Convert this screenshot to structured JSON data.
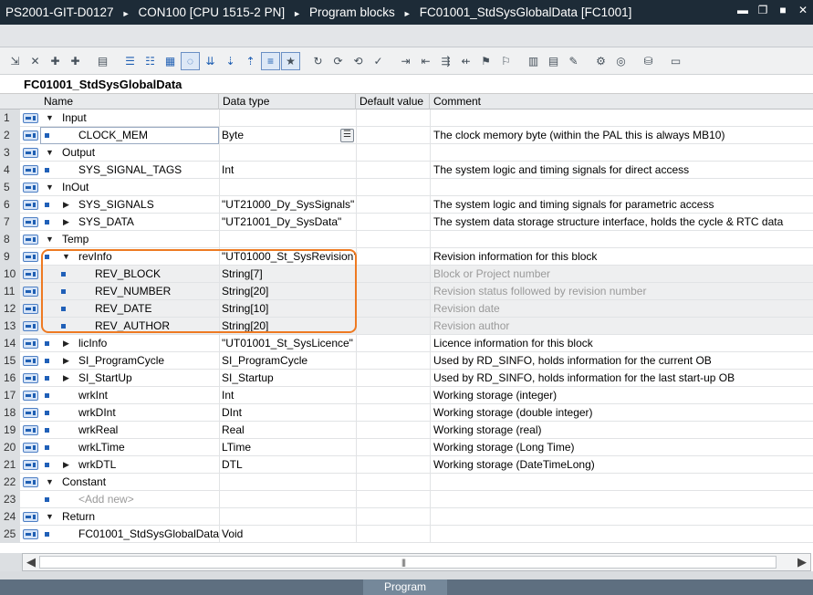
{
  "window": {
    "breadcrumb": [
      "PS2001-GIT-D0127",
      "CON100 [CPU 1515-2 PN]",
      "Program blocks",
      "FC01001_StdSysGlobalData [FC1001]"
    ],
    "controls": [
      "minimize",
      "restore",
      "maximize",
      "close"
    ]
  },
  "toolbar": {
    "icons": [
      "insert-row-icon",
      "delete-row-icon",
      "insert-network-icon",
      "add-network-icon",
      "monitor-icon",
      "view-block-icon",
      "view-network-icon",
      "view-table-icon",
      "comment-icon",
      "expand-all-icon",
      "expand-icon",
      "collapse-icon",
      "list-icon",
      "favorites-icon",
      "goto-icon",
      "goto-next-icon",
      "goto-prev-icon",
      "check-icon",
      "indent-icon",
      "outdent-icon",
      "comment-lines-icon",
      "uncomment-lines-icon",
      "bookmark-icon",
      "bookmark-next-icon",
      "columns-icon",
      "rows-icon",
      "pencil-icon",
      "monitoring-icon",
      "glasses-icon",
      "snapshot-icon",
      "more-icon"
    ]
  },
  "block": {
    "title": "FC01001_StdSysGlobalData"
  },
  "columns": {
    "name": "Name",
    "type": "Data type",
    "default": "Default value",
    "comment": "Comment"
  },
  "rows": [
    {
      "num": "1",
      "name": "Input",
      "type": "",
      "comment": ""
    },
    {
      "num": "2",
      "name": "CLOCK_MEM",
      "type": "Byte",
      "comment": "The clock memory byte (within the PAL this is always MB10)"
    },
    {
      "num": "3",
      "name": "Output",
      "type": "",
      "comment": ""
    },
    {
      "num": "4",
      "name": "SYS_SIGNAL_TAGS",
      "type": "Int",
      "comment": "The system logic and timing signals for direct access"
    },
    {
      "num": "5",
      "name": "InOut",
      "type": "",
      "comment": ""
    },
    {
      "num": "6",
      "name": "SYS_SIGNALS",
      "type": "\"UT21000_Dy_SysSignals\"",
      "comment": "The system logic and timing signals for parametric access"
    },
    {
      "num": "7",
      "name": "SYS_DATA",
      "type": "\"UT21001_Dy_SysData\"",
      "comment": "The system data storage structure interface, holds the cycle & RTC data"
    },
    {
      "num": "8",
      "name": "Temp",
      "type": "",
      "comment": ""
    },
    {
      "num": "9",
      "name": "revInfo",
      "type": "\"UT01000_St_SysRevision\"",
      "comment": "Revision information for this block"
    },
    {
      "num": "10",
      "name": "REV_BLOCK",
      "type": "String[7]",
      "comment": "Block or Project number"
    },
    {
      "num": "11",
      "name": "REV_NUMBER",
      "type": "String[20]",
      "comment": "Revision status followed by revision number"
    },
    {
      "num": "12",
      "name": "REV_DATE",
      "type": "String[10]",
      "comment": "Revision date"
    },
    {
      "num": "13",
      "name": "REV_AUTHOR",
      "type": "String[20]",
      "comment": "Revision author"
    },
    {
      "num": "14",
      "name": "licInfo",
      "type": "\"UT01001_St_SysLicence\"",
      "comment": "Licence information for this block"
    },
    {
      "num": "15",
      "name": "SI_ProgramCycle",
      "type": "SI_ProgramCycle",
      "comment": "Used by RD_SINFO, holds information for the current OB"
    },
    {
      "num": "16",
      "name": "SI_StartUp",
      "type": "SI_Startup",
      "comment": "Used by RD_SINFO, holds information for the last start-up OB"
    },
    {
      "num": "17",
      "name": "wrkInt",
      "type": "Int",
      "comment": "Working storage (integer)"
    },
    {
      "num": "18",
      "name": "wrkDInt",
      "type": "DInt",
      "comment": "Working storage (double integer)"
    },
    {
      "num": "19",
      "name": "wrkReal",
      "type": "Real",
      "comment": "Working storage (real)"
    },
    {
      "num": "20",
      "name": "wrkLTime",
      "type": "LTime",
      "comment": "Working storage (Long Time)"
    },
    {
      "num": "21",
      "name": "wrkDTL",
      "type": "DTL",
      "comment": "Working storage (DateTimeLong)"
    },
    {
      "num": "22",
      "name": "Constant",
      "type": "",
      "comment": ""
    },
    {
      "num": "23",
      "name": "<Add new>",
      "type": "",
      "comment": ""
    },
    {
      "num": "24",
      "name": "Return",
      "type": "",
      "comment": ""
    },
    {
      "num": "25",
      "name": "FC01001_StdSysGlobalData",
      "type": "Void",
      "comment": ""
    }
  ],
  "scrollbar": {
    "grip": "|||"
  },
  "status": {
    "label": "Program"
  },
  "colors": {
    "highlight": "#ee7a22",
    "titlebar": "#1d2b37",
    "accent": "#2060b8"
  }
}
